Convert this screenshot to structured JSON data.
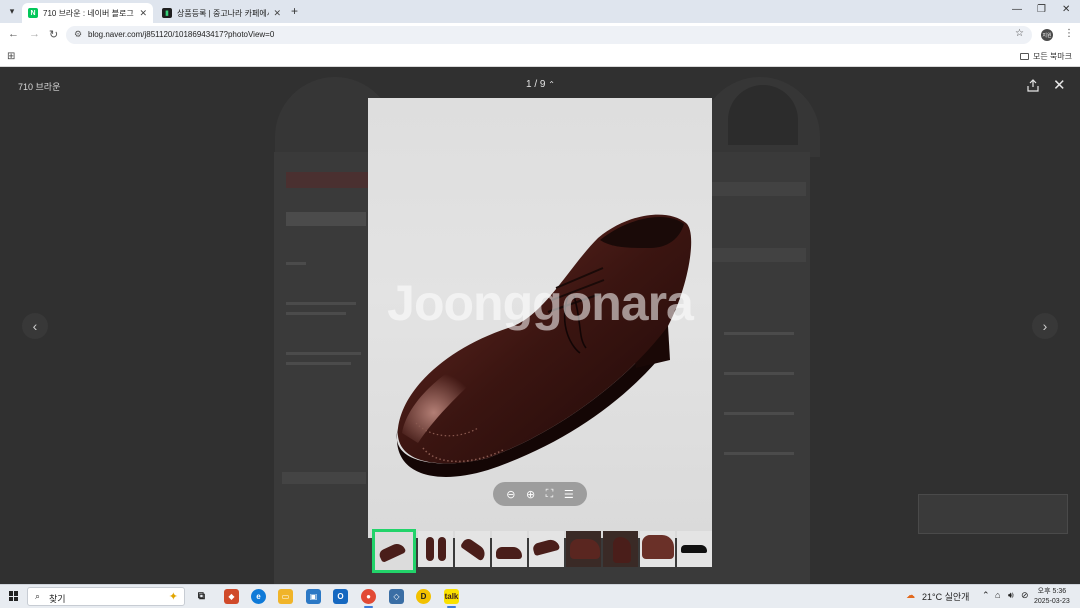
{
  "browser": {
    "tabs": [
      {
        "title": "710 브라운 : 네이버 블로그",
        "favicon": "naver-blog-icon",
        "active": true
      },
      {
        "title": "상품등록 | 중고나라 카페에서",
        "favicon": "joonggonara-icon",
        "active": false
      }
    ],
    "url": "blog.naver.com/j851120/10186943417?photoView=0",
    "profile_initials": "지원",
    "bookmarks_label": "모든 북마크"
  },
  "viewer": {
    "title": "710 브라운",
    "counter": "1 / 9",
    "watermark": "Joonggonara",
    "thumbnail_count": 9,
    "selected_thumbnail": 1
  },
  "taskbar": {
    "search_placeholder": "찾기",
    "weather": "21°C  실안개",
    "time": "오후 5:36",
    "date": "2025-03-23"
  },
  "colors": {
    "selected_thumb_border": "#22d36a",
    "overlay_bg": "#303030",
    "shoe_color": "#4a1e1a"
  }
}
